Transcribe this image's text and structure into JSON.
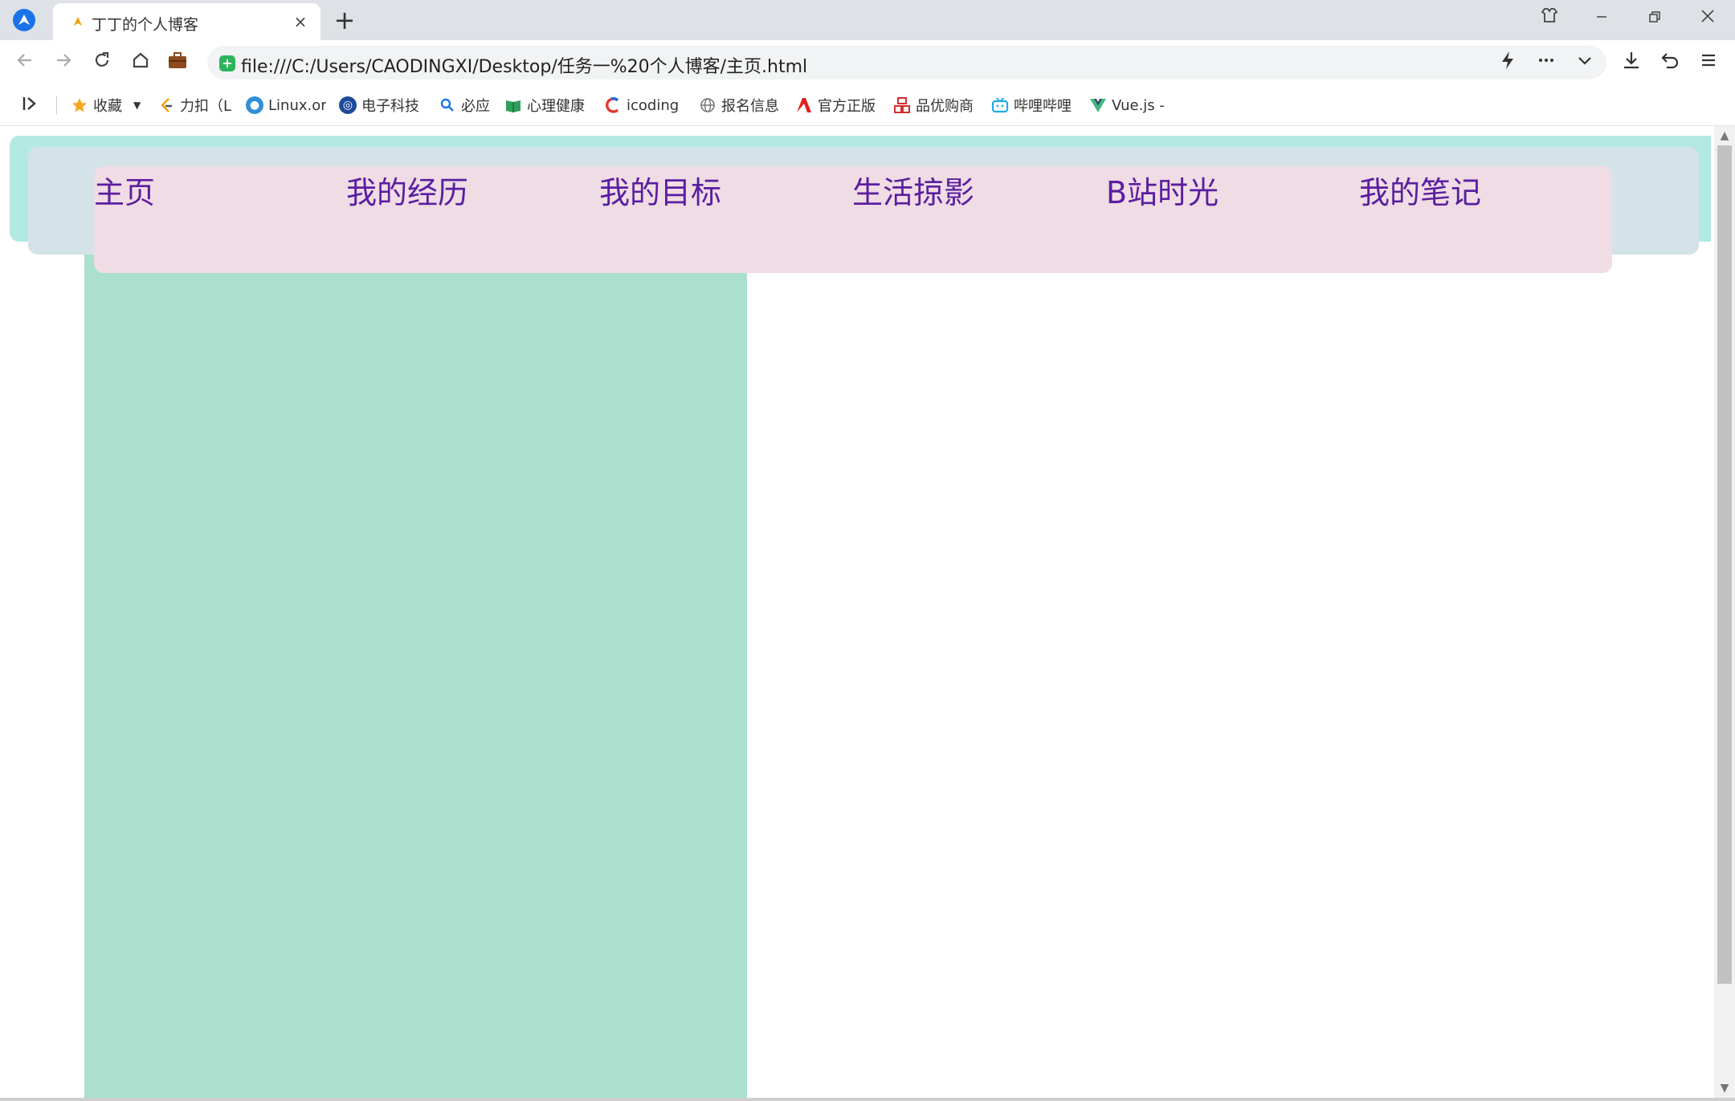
{
  "browser": {
    "tab_title": "丁丁的个人博客",
    "new_tab_label": "+",
    "close_label": "×",
    "url": "file:///C:/Users/CAODINGXI/Desktop/任务一%20个人博客/主页.html"
  },
  "bookmarks": [
    {
      "label": "收藏",
      "icon": "star-icon",
      "color": "#f5a623"
    },
    {
      "label": "力扣（L",
      "icon": "leetcode-icon",
      "color": "#f0a000"
    },
    {
      "label": "Linux.or",
      "icon": "linux-icon",
      "color": "#2f8fd8"
    },
    {
      "label": "电子科技",
      "icon": "uestc-icon",
      "color": "#1d4a9a"
    },
    {
      "label": "必应",
      "icon": "search-icon",
      "color": "#1a73e8"
    },
    {
      "label": "心理健康",
      "icon": "book-icon",
      "color": "#2e9e5b"
    },
    {
      "label": "icoding",
      "icon": "icoding-icon",
      "color": "#e53935"
    },
    {
      "label": "报名信息",
      "icon": "globe-icon",
      "color": "#777777"
    },
    {
      "label": "官方正版",
      "icon": "adobe-icon",
      "color": "#e02020"
    },
    {
      "label": "品优购商",
      "icon": "shop-icon",
      "color": "#d32f2f"
    },
    {
      "label": "哔哩哔哩",
      "icon": "bilibili-icon",
      "color": "#23ade5"
    },
    {
      "label": "Vue.js -",
      "icon": "vue-icon",
      "color": "#41b883"
    }
  ],
  "nav": {
    "items": [
      "主页",
      "我的经历",
      "我的目标",
      "生活掠影",
      "B站时光",
      "我的笔记"
    ]
  },
  "colors": {
    "nav_text": "#5a1ea0",
    "header_outer": "#b3e9e3",
    "header_inner": "#d3e3e7",
    "navbar_bg": "#efdce4",
    "left_column": "#aae0cd"
  }
}
